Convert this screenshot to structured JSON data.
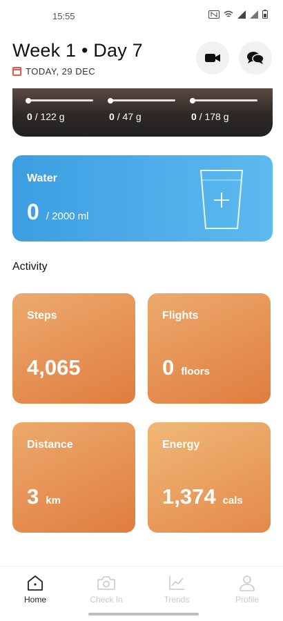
{
  "status_bar": {
    "time": "15:55",
    "icons": [
      "nfc-icon",
      "wifi-icon",
      "signal-icon",
      "signal-icon",
      "battery-icon"
    ]
  },
  "header": {
    "title": "Week 1 • Day 7",
    "date": "TODAY, 29 DEC"
  },
  "macros": [
    {
      "value": "0",
      "target": "/ 122 g",
      "progress": 0
    },
    {
      "value": "0",
      "target": "/ 47 g",
      "progress": 0
    },
    {
      "value": "0",
      "target": "/ 178 g",
      "progress": 0
    }
  ],
  "water": {
    "title": "Water",
    "amount": "0",
    "goal": "/ 2000 ml"
  },
  "activity": {
    "label": "Activity",
    "tiles": [
      {
        "title": "Steps",
        "value": "4,065",
        "unit": ""
      },
      {
        "title": "Flights",
        "value": "0",
        "unit": "floors"
      },
      {
        "title": "Distance",
        "value": "3",
        "unit": "km"
      },
      {
        "title": "Energy",
        "value": "1,374",
        "unit": "cals"
      }
    ]
  },
  "nav": {
    "items": [
      {
        "label": "Home",
        "icon": "home-icon",
        "active": true
      },
      {
        "label": "Check In",
        "icon": "camera-icon",
        "active": false
      },
      {
        "label": "Trends",
        "icon": "chart-icon",
        "active": false
      },
      {
        "label": "Profile",
        "icon": "person-icon",
        "active": false
      }
    ]
  },
  "colors": {
    "water": "#3c9ee2",
    "activity": "#e07d3e",
    "date_icon": "#e0584f"
  }
}
